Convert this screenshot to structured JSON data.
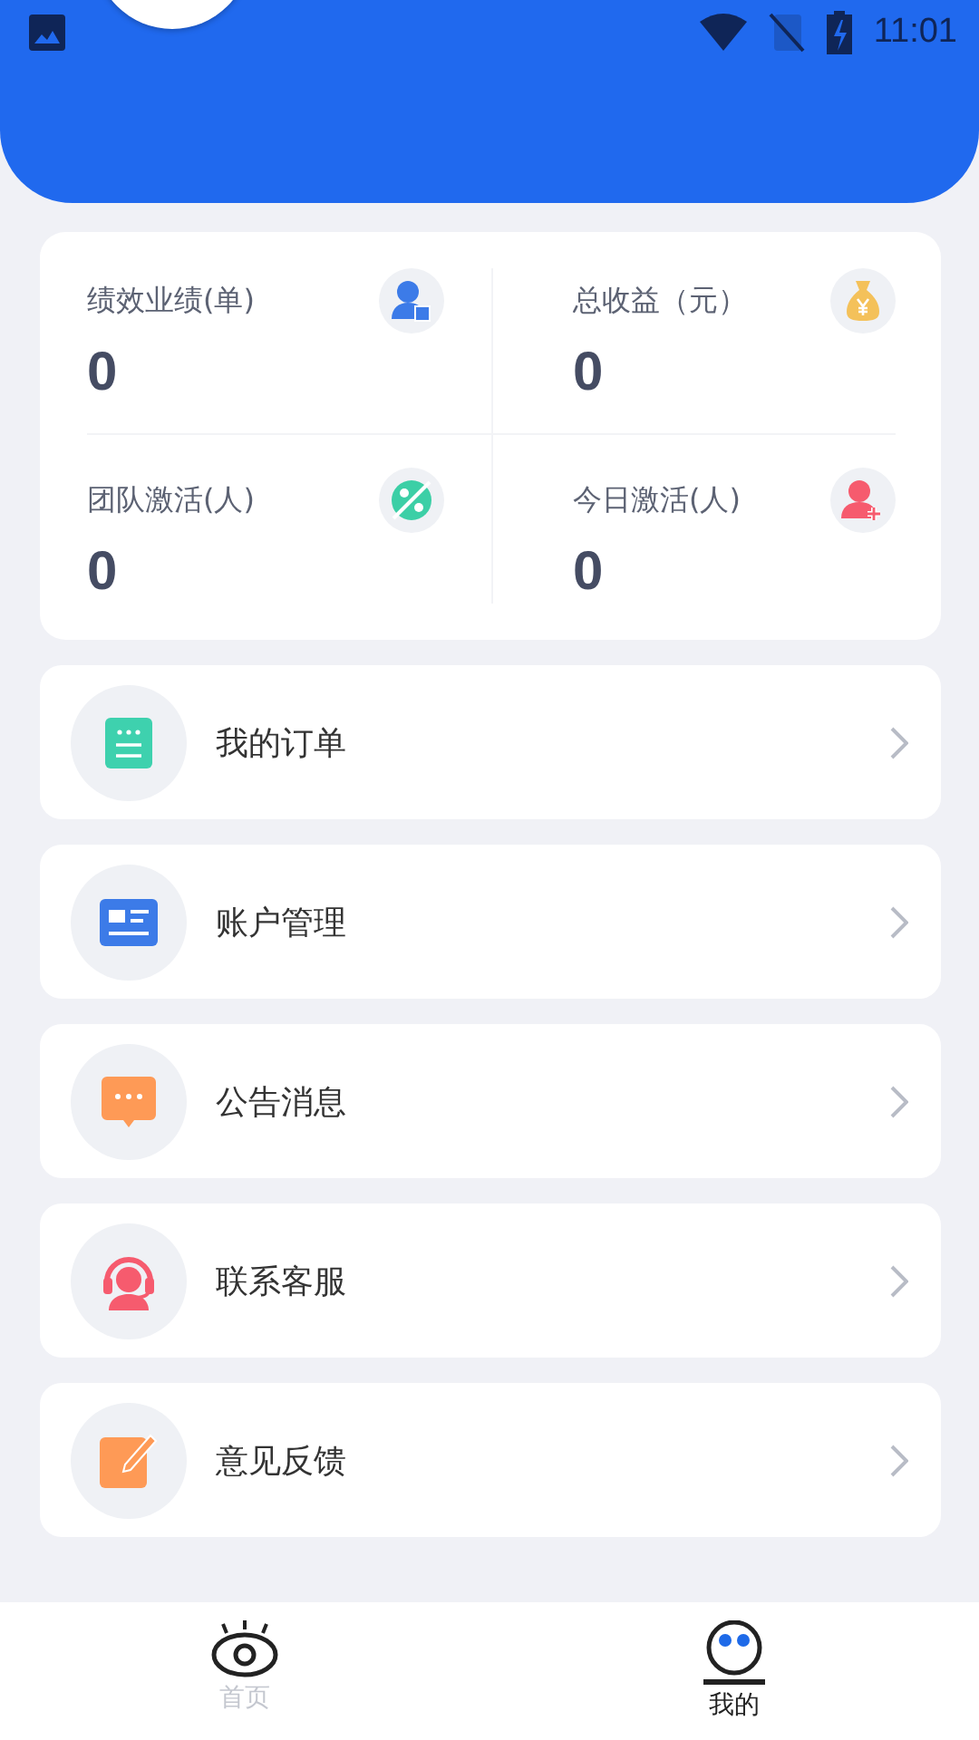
{
  "status_bar": {
    "time": "11:01"
  },
  "stats": [
    {
      "label": "绩效业绩(单)",
      "value": "0",
      "kind": "person"
    },
    {
      "label": "总收益（元）",
      "value": "0",
      "kind": "money"
    },
    {
      "label": "团队激活(人)",
      "value": "0",
      "kind": "planet"
    },
    {
      "label": "今日激活(人)",
      "value": "0",
      "kind": "adduser"
    }
  ],
  "menu": [
    {
      "label": "我的订单",
      "kind": "order"
    },
    {
      "label": "账户管理",
      "kind": "account"
    },
    {
      "label": "公告消息",
      "kind": "message"
    },
    {
      "label": "联系客服",
      "kind": "support"
    },
    {
      "label": "意见反馈",
      "kind": "feedback"
    }
  ],
  "tabs": [
    {
      "label": "首页",
      "kind": "home",
      "selected": false
    },
    {
      "label": "我的",
      "kind": "mine",
      "selected": true
    }
  ]
}
